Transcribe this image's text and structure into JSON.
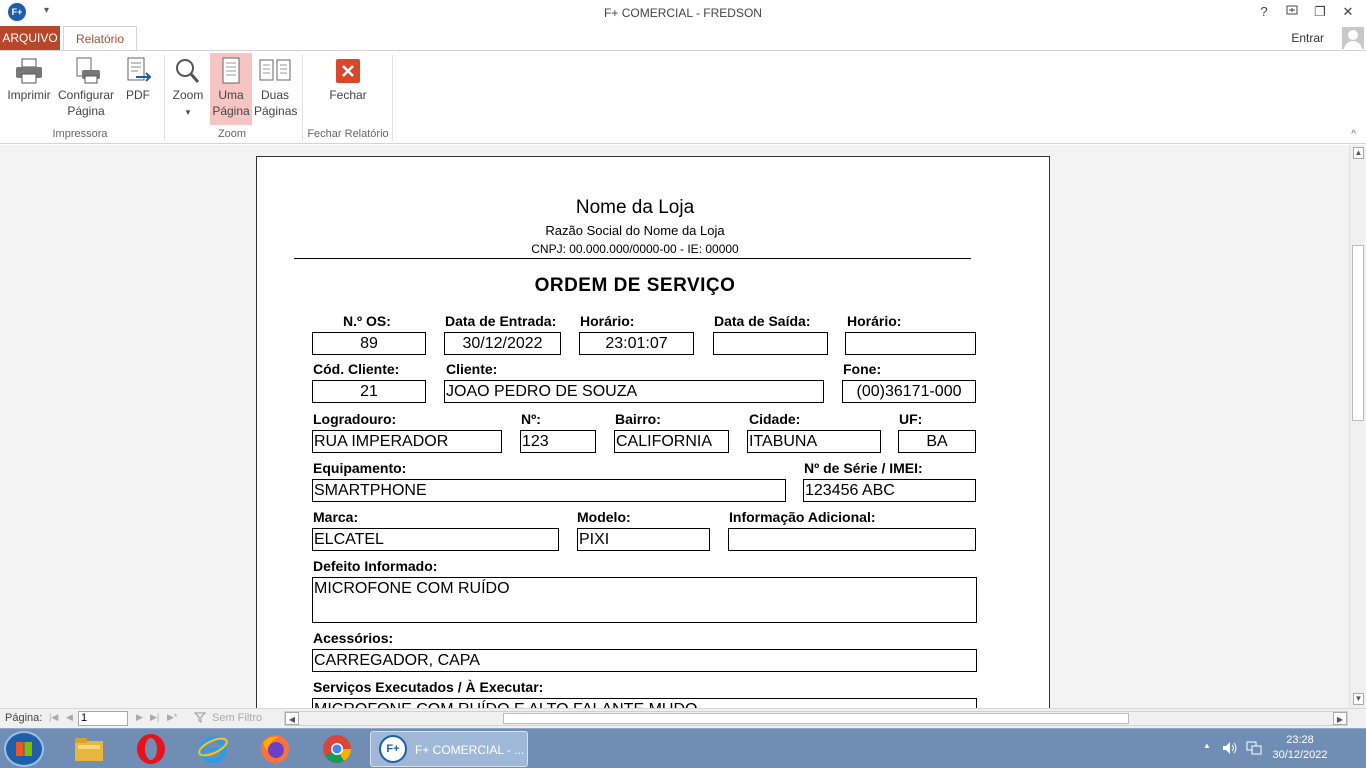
{
  "window": {
    "title": "F+ COMERCIAL - FREDSON",
    "logo_text": "F+",
    "help": "?",
    "minimize": "—",
    "restore": "❐",
    "close": "✕",
    "qat_arrow": "▾"
  },
  "tabs": {
    "arquivo": "ARQUIVO",
    "relatorio": "Relatório",
    "entrar": "Entrar"
  },
  "ribbon": {
    "imprimir": "Imprimir",
    "configurar_1": "Configurar",
    "configurar_2": "Página",
    "pdf": "PDF",
    "zoom": "Zoom",
    "zoom_arrow": "▾",
    "uma_1": "Uma",
    "uma_2": "Página",
    "duas_1": "Duas",
    "duas_2": "Páginas",
    "fechar": "Fechar",
    "group_impressora": "Impressora",
    "group_zoom": "Zoom",
    "group_fechar": "Fechar Relatório",
    "collapse": "^"
  },
  "report": {
    "store_name": "Nome da Loja",
    "razao_social": "Razão Social do Nome da Loja",
    "cnpj": "CNPJ: 00.000.000/0000-00 - IE: 00000",
    "title": "ORDEM DE SERVIÇO",
    "labels": {
      "n_os": "N.º OS:",
      "data_entrada": "Data de Entrada:",
      "horario": "Horário:",
      "data_saida": "Data de Saída:",
      "horario2": "Horário:",
      "cod_cliente": "Cód. Cliente:",
      "cliente": "Cliente:",
      "fone": "Fone:",
      "logradouro": "Logradouro:",
      "numero": "Nº:",
      "bairro": "Bairro:",
      "cidade": "Cidade:",
      "uf": "UF:",
      "equipamento": "Equipamento:",
      "serie": "Nº de Série / IMEI:",
      "marca": "Marca:",
      "modelo": "Modelo:",
      "info_adicional": "Informação Adicional:",
      "defeito": "Defeito Informado:",
      "acessorios": "Acessórios:",
      "servicos": "Serviços Executados / À Executar:"
    },
    "values": {
      "n_os": "89",
      "data_entrada": "30/12/2022",
      "horario": "23:01:07",
      "data_saida": "",
      "horario2": "",
      "cod_cliente": "21",
      "cliente": "JOAO PEDRO DE SOUZA",
      "fone": "(00)36171-000",
      "logradouro": "RUA IMPERADOR",
      "numero": "123",
      "bairro": "CALIFORNIA",
      "cidade": "ITABUNA",
      "uf": "BA",
      "equipamento": "SMARTPHONE",
      "serie": "123456 ABC",
      "marca": "ELCATEL",
      "modelo": "PIXI",
      "info_adicional": "",
      "defeito": "MICROFONE COM RUÍDO",
      "acessorios": "CARREGADOR, CAPA",
      "servicos": "MICROFONE COM RUÍDO E ALTO FALANTE MUDO"
    }
  },
  "statusbar": {
    "pagina_label": "Página:",
    "page_value": "1",
    "nav_first": "|◀",
    "nav_prev": "◀",
    "nav_next": "▶",
    "nav_last": "▶|",
    "nav_new": "▶*",
    "filter": "Sem Filtro"
  },
  "taskbar": {
    "active_app": "F+ COMERCIAL - ...",
    "time": "23:28",
    "date": "30/12/2022",
    "tray_arrow": "▲"
  }
}
